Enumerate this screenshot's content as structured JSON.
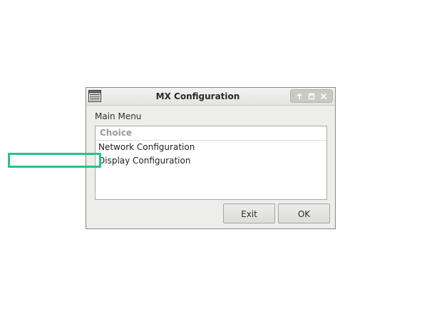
{
  "window": {
    "title": "MX Configuration",
    "app_icon": "list-window-icon",
    "controls": [
      {
        "name": "up-arrow-icon",
        "symbol": "↑"
      },
      {
        "name": "maximize-icon",
        "symbol": "□"
      },
      {
        "name": "close-icon",
        "symbol": "✕"
      }
    ]
  },
  "main": {
    "menu_label": "Main Menu",
    "list_header": "Choice",
    "items": [
      {
        "label": "Network Configuration",
        "highlighted": false
      },
      {
        "label": "Display Configuration",
        "highlighted": true
      }
    ],
    "highlight_color": "#21c48c"
  },
  "buttons": {
    "exit_label": "Exit",
    "ok_label": "OK"
  }
}
